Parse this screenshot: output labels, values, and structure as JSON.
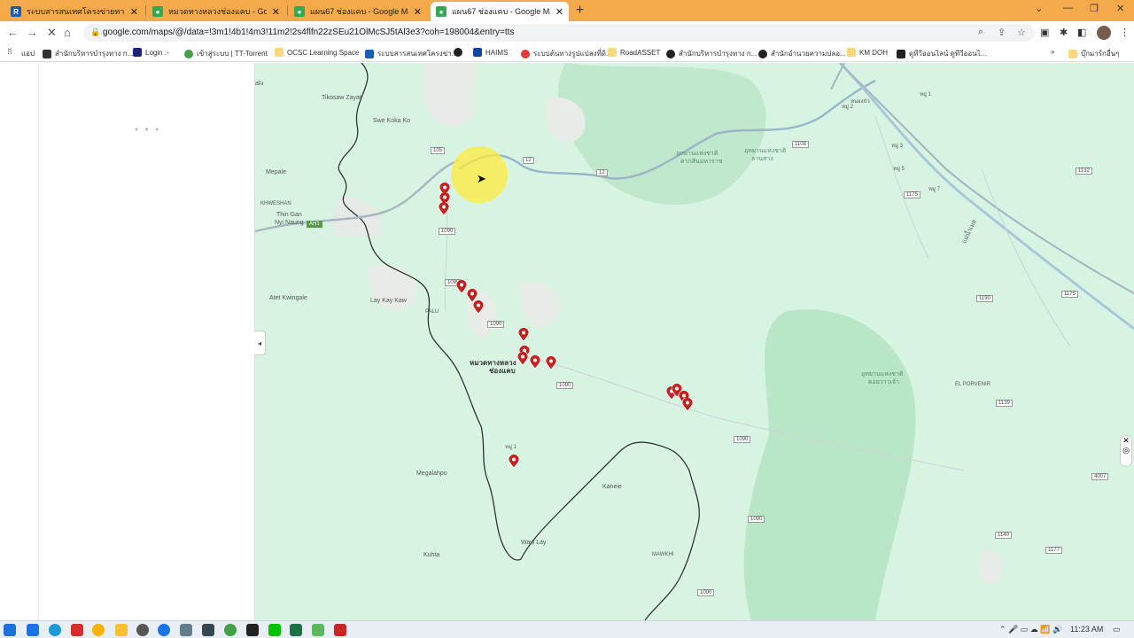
{
  "browser": {
    "tabs": [
      {
        "title": "ระบบสารสนเทศโครงข่ายทางหลวง",
        "icon": "R",
        "color": "#1a5fb4",
        "active": false
      },
      {
        "title": "หมวดทางหลวงช่องแคบ - Google M",
        "icon": "maps-icon",
        "color": "#34a853",
        "active": false
      },
      {
        "title": "แผน67 ช่องแคบ - Google Maps",
        "icon": "maps-icon",
        "color": "#34a853",
        "active": false
      },
      {
        "title": "แผน67 ช่องแคบ - Google Maps",
        "icon": "maps-icon",
        "color": "#34a853",
        "active": true
      }
    ],
    "url": "google.com/maps/@/data=!3m1!4b1!4m3!11m2!2s4flfn22zSEu21OlMcSJ5tAl3e3?coh=198004&entry=tts"
  },
  "bookmarks": [
    {
      "label": "แอป",
      "color": "#666"
    },
    {
      "label": "สำนักบริหารบำรุงทาง ก...",
      "color": "#333"
    },
    {
      "label": "Login :-",
      "color": "#1a237e"
    },
    {
      "label": "เข้าสู่ระบบ | TT-Torrent",
      "color": "#43a047"
    },
    {
      "label": "OCSC Learning Space",
      "color": "#f9a825"
    },
    {
      "label": "ระบบสารสนเทศโครงข่า...",
      "color": "#1a5fb4"
    },
    {
      "label": "",
      "color": "#222"
    },
    {
      "label": "HAIMS",
      "color": "#0d47a1"
    },
    {
      "label": "ระบบต้นทางรูปแปลงที่ดิ...",
      "color": "#e53935"
    },
    {
      "label": "RoadASSET",
      "color": "#f9a825"
    },
    {
      "label": "สำนักบริหารบำรุงทาง ก...",
      "color": "#222"
    },
    {
      "label": "สำนักอำนวยความปลอ...",
      "color": "#222"
    },
    {
      "label": "KM DOH",
      "color": "#f9a825"
    },
    {
      "label": "ดูทีวีออนไลน์ ดูทีวีออนไ...",
      "color": "#222"
    },
    {
      "label": "บุ๊กมาร์กอื่นๆ",
      "color": "#f9a825"
    }
  ],
  "map": {
    "labels": {
      "alu": "alu",
      "tikosaw": "Tikosaw Zayat",
      "swekoka": "Swe Koka Ko",
      "mepale": "Mepale",
      "khweshan": "KHWESHAN",
      "thingan": "Thin Gan",
      "nyinaung": "Nyi Naung",
      "atetkwingale": "Atet Kwingale",
      "laykaykaw": "Lay Kay Kaw",
      "palu": "PALU",
      "district1": "หมวดทางหลวง",
      "district2": "ช่องแคบ",
      "mu1": "หมู่ 1",
      "megalahpo": "Megalahpo",
      "kaneie": "Kaneie",
      "wawlay": "Waw Lay",
      "kuhta": "Kuhta",
      "mawkhi": "MAWKHI",
      "elporvenir": "EL PORVENIR",
      "park1a": "อุทยานแห่งชาติ",
      "park1b": "ตากสินมหาราช",
      "park2a": "อุทยานแห่งชาติ",
      "park2b": "ลานสาง",
      "park3a": "อุทยานแห่งชาติ",
      "park3b": "ดอยวาวเจ้า",
      "river": "แม่น้ำเมย",
      "mu3": "หมู่ 3",
      "mu7": "หมู่ 7",
      "mu5": "หมู่ 5",
      "mu2": "หมู่ 2",
      "mu1b": "หมู่ 1",
      "nongbua": "หนองบัว"
    },
    "routes": [
      "105",
      "12",
      "12",
      "1090",
      "1090",
      "1090",
      "1090",
      "1090",
      "1090",
      "1090",
      "1108",
      "1132",
      "1175",
      "1175",
      "1190",
      "1139",
      "1140",
      "1177",
      "4007",
      "1139",
      "AH1",
      "1090",
      "1132"
    ],
    "pin_color": "#c5221f"
  },
  "taskbar": {
    "time": "11:23 AM",
    "apps": [
      "start",
      "search",
      "taskview",
      "edge",
      "chrome",
      "explorer",
      "photos",
      "app",
      "app",
      "app",
      "app",
      "line",
      "excel",
      "app",
      "app"
    ]
  }
}
